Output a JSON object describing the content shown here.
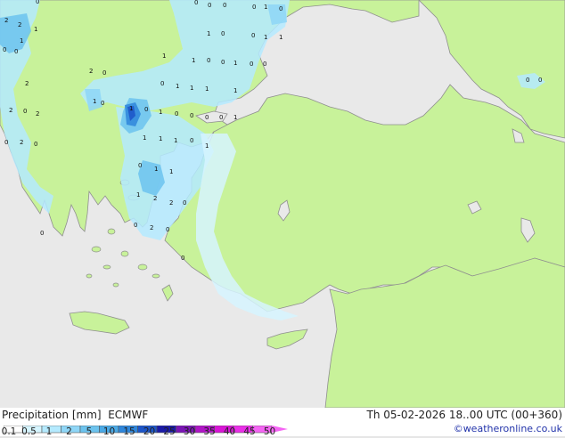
{
  "footer": {
    "title": "Precipitation [mm]  ECMWF",
    "run_info": "Th 05-02-2026 18..00 UTC (00+360)",
    "credit": "©weatheronline.co.uk"
  },
  "legend": {
    "ticks": [
      "0.1",
      "0.5",
      "1",
      "2",
      "5",
      "10",
      "15",
      "20",
      "25",
      "30",
      "35",
      "40",
      "45",
      "50"
    ],
    "colors": [
      "#ffffff",
      "#d6f5ff",
      "#b4eaff",
      "#8ed6f7",
      "#6cc3ee",
      "#4aa9e6",
      "#2e86db",
      "#1c55c8",
      "#1a1aa6",
      "#7a14b4",
      "#b014c6",
      "#d914d6",
      "#ea2ee8",
      "#f564f4"
    ]
  },
  "map": {
    "land_color": "#c8f29a",
    "sea_color": "#e9e9e9",
    "coast_color": "#8f8f8f",
    "precip_values": [
      "2",
      "2",
      "1",
      "1",
      "0",
      "0",
      "0",
      "0",
      "0",
      "0",
      "0",
      "1",
      "0",
      "1",
      "0",
      "0",
      "1",
      "1",
      "1",
      "1",
      "0",
      "0",
      "1",
      "0",
      "0",
      "2",
      "0",
      "0",
      "1",
      "1",
      "1",
      "1",
      "2",
      "2",
      "0",
      "2",
      "1",
      "0",
      "0",
      "1",
      "0",
      "0",
      "0",
      "0",
      "1",
      "1",
      "0",
      "2",
      "0",
      "1",
      "1",
      "1",
      "0",
      "1",
      "0",
      "1",
      "1",
      "1",
      "2",
      "2",
      "0",
      "0",
      "2",
      "0",
      "0",
      "0",
      "0",
      "0"
    ]
  }
}
